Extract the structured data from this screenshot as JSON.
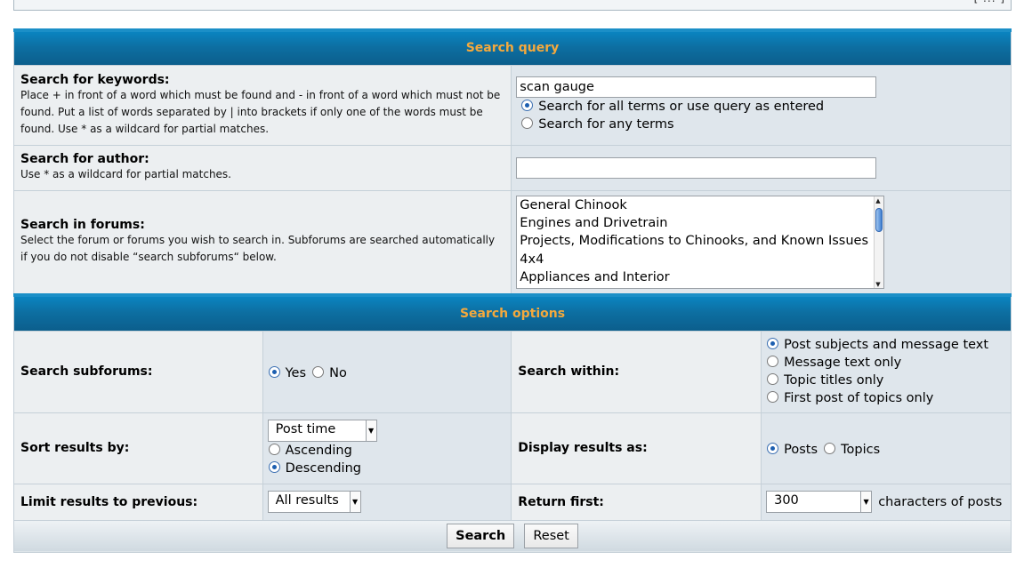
{
  "header_tail": "[ ... ]",
  "search_query": {
    "title": "Search query",
    "keywords": {
      "label": "Search for keywords:",
      "help": "Place + in front of a word which must be found and - in front of a word which must not be found. Put a list of words separated by | into brackets if only one of the words must be found. Use * as a wildcard for partial matches.",
      "value": "scan gauge",
      "options": [
        "Search for all terms or use query as entered",
        "Search for any terms"
      ],
      "selected": 0
    },
    "author": {
      "label": "Search for author:",
      "help": "Use * as a wildcard for partial matches.",
      "value": ""
    },
    "forums": {
      "label": "Search in forums:",
      "help": "Select the forum or forums you wish to search in. Subforums are searched automatically if you do not disable “search subforums“ below.",
      "items": [
        "General Chinook",
        "Engines and Drivetrain",
        "Projects, Modifications to Chinooks, and Known Issues",
        "4x4",
        "Appliances and Interior"
      ]
    }
  },
  "search_options": {
    "title": "Search options",
    "subforums": {
      "label": "Search subforums:",
      "yes": "Yes",
      "no": "No",
      "selected": "yes"
    },
    "within": {
      "label": "Search within:",
      "options": [
        "Post subjects and message text",
        "Message text only",
        "Topic titles only",
        "First post of topics only"
      ],
      "selected": 0
    },
    "sort": {
      "label": "Sort results by:",
      "value": "Post time",
      "ascending": "Ascending",
      "descending": "Descending",
      "selected": "descending"
    },
    "display": {
      "label": "Display results as:",
      "posts": "Posts",
      "topics": "Topics",
      "selected": "posts"
    },
    "limit": {
      "label": "Limit results to previous:",
      "value": "All results"
    },
    "return_first": {
      "label": "Return first:",
      "value": "300",
      "suffix": "characters of posts"
    }
  },
  "buttons": {
    "search": "Search",
    "reset": "Reset"
  },
  "icons": {
    "radio": "radio-icon",
    "dropdown": "chevron-down-icon"
  },
  "colors": {
    "header_bg": "#0d6fa2",
    "header_text": "#f4a93d",
    "row1": "#eceff1",
    "row2": "#dfe6ec"
  }
}
